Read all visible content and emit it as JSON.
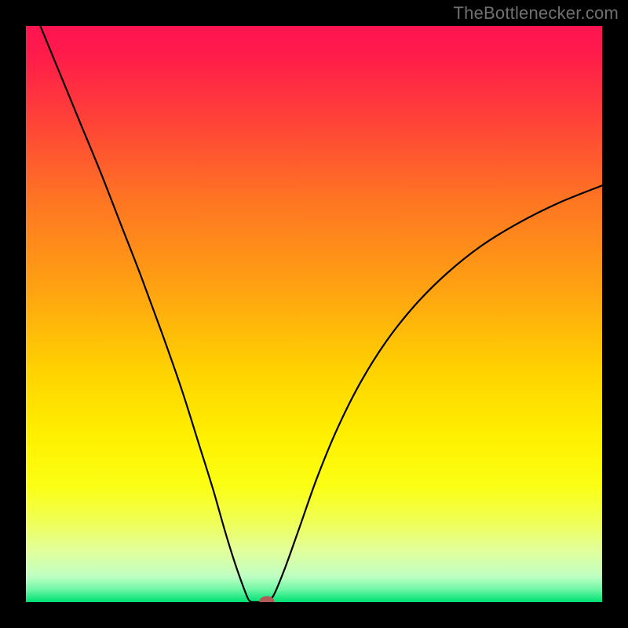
{
  "credit": "TheBottlenecker.com",
  "chart_data": {
    "type": "line",
    "title": "",
    "xlabel": "",
    "ylabel": "",
    "xlim": [
      0,
      1
    ],
    "ylim": [
      0,
      1
    ],
    "gradient_stops": [
      {
        "offset": 0.0,
        "color": "#ff1450"
      },
      {
        "offset": 0.05,
        "color": "#ff1b4a"
      },
      {
        "offset": 0.15,
        "color": "#ff3d3a"
      },
      {
        "offset": 0.3,
        "color": "#ff7423"
      },
      {
        "offset": 0.45,
        "color": "#ffa012"
      },
      {
        "offset": 0.6,
        "color": "#ffd300"
      },
      {
        "offset": 0.72,
        "color": "#fff200"
      },
      {
        "offset": 0.8,
        "color": "#fbff15"
      },
      {
        "offset": 0.86,
        "color": "#f0ff55"
      },
      {
        "offset": 0.91,
        "color": "#e2ff9a"
      },
      {
        "offset": 0.955,
        "color": "#c0ffc3"
      },
      {
        "offset": 0.978,
        "color": "#70f7a5"
      },
      {
        "offset": 0.992,
        "color": "#25e985"
      },
      {
        "offset": 1.0,
        "color": "#00e070"
      }
    ],
    "series": [
      {
        "name": "left-branch",
        "points": [
          {
            "x": 0.025,
            "y": 1.0
          },
          {
            "x": 0.06,
            "y": 0.915
          },
          {
            "x": 0.095,
            "y": 0.83
          },
          {
            "x": 0.13,
            "y": 0.745
          },
          {
            "x": 0.165,
            "y": 0.655
          },
          {
            "x": 0.2,
            "y": 0.565
          },
          {
            "x": 0.235,
            "y": 0.47
          },
          {
            "x": 0.27,
            "y": 0.37
          },
          {
            "x": 0.3,
            "y": 0.275
          },
          {
            "x": 0.325,
            "y": 0.195
          },
          {
            "x": 0.345,
            "y": 0.125
          },
          {
            "x": 0.362,
            "y": 0.07
          },
          {
            "x": 0.376,
            "y": 0.03
          },
          {
            "x": 0.386,
            "y": 0.005
          },
          {
            "x": 0.392,
            "y": 0.0
          }
        ]
      },
      {
        "name": "valley-floor",
        "points": [
          {
            "x": 0.392,
            "y": 0.0
          },
          {
            "x": 0.418,
            "y": 0.0
          }
        ]
      },
      {
        "name": "right-branch",
        "points": [
          {
            "x": 0.418,
            "y": 0.0
          },
          {
            "x": 0.43,
            "y": 0.012
          },
          {
            "x": 0.45,
            "y": 0.06
          },
          {
            "x": 0.475,
            "y": 0.13
          },
          {
            "x": 0.505,
            "y": 0.215
          },
          {
            "x": 0.54,
            "y": 0.3
          },
          {
            "x": 0.58,
            "y": 0.38
          },
          {
            "x": 0.625,
            "y": 0.452
          },
          {
            "x": 0.675,
            "y": 0.515
          },
          {
            "x": 0.73,
            "y": 0.57
          },
          {
            "x": 0.79,
            "y": 0.618
          },
          {
            "x": 0.855,
            "y": 0.658
          },
          {
            "x": 0.925,
            "y": 0.693
          },
          {
            "x": 1.0,
            "y": 0.723
          }
        ]
      }
    ],
    "marker": {
      "x": 0.418,
      "y": 0.0,
      "rx": 0.013,
      "ry": 0.009,
      "color": "#b25a56"
    }
  }
}
